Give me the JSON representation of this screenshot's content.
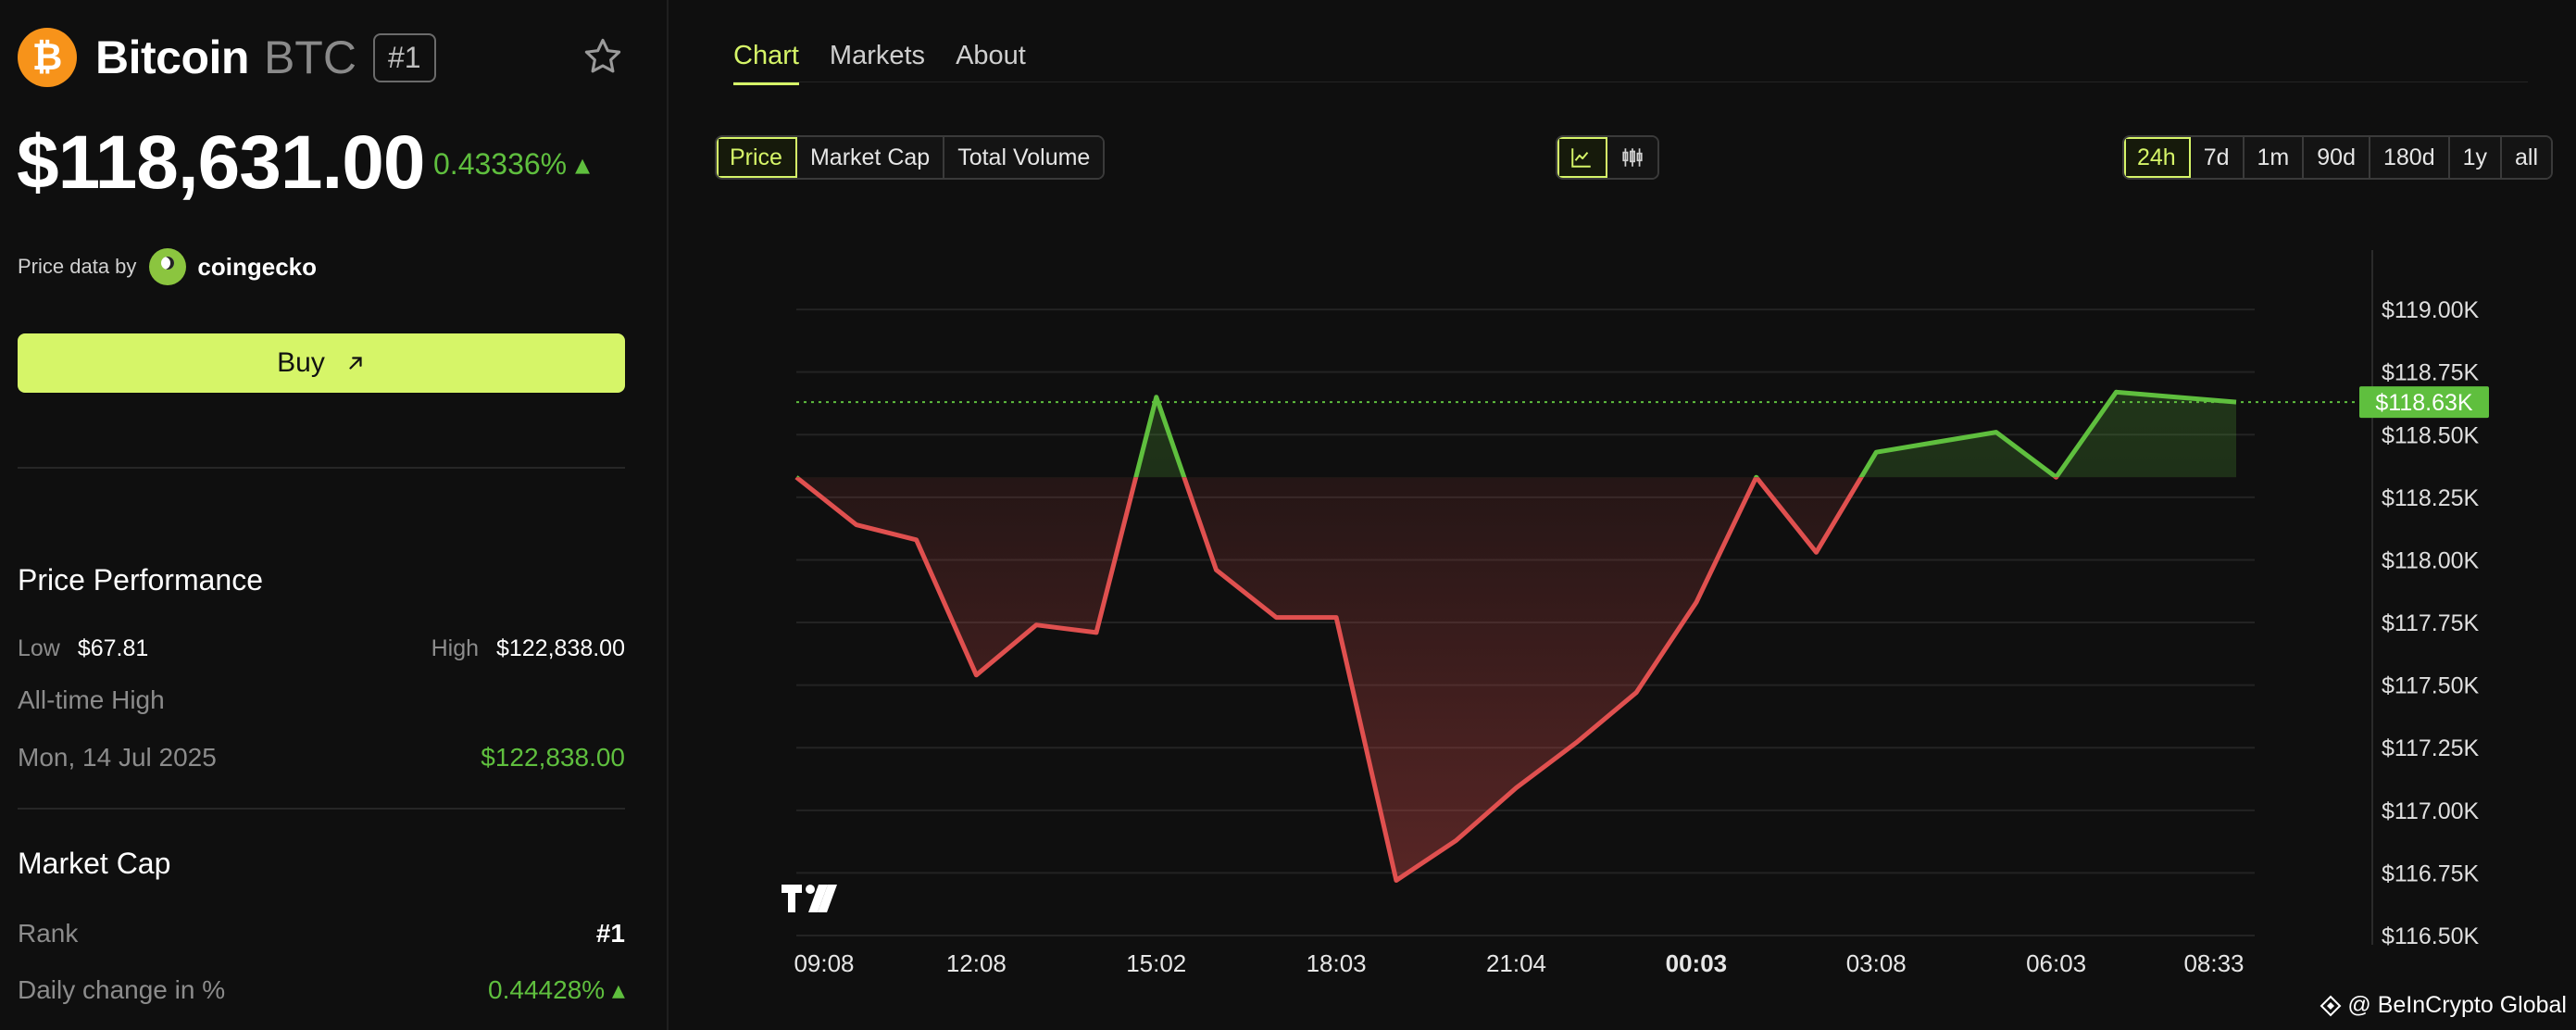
{
  "coin": {
    "logo_glyph": "₿",
    "name": "Bitcoin",
    "symbol": "BTC",
    "rank": "#1",
    "price": "$118,631.00",
    "change": "0.43336% ▴"
  },
  "attribution": {
    "label": "Price data by",
    "provider": "coingecko"
  },
  "buy_label": "Buy",
  "performance": {
    "title": "Price Performance",
    "low_label": "Low",
    "low_value": "$67.81",
    "high_label": "High",
    "high_value": "$122,838.00",
    "ath_label": "All-time High",
    "ath_date": "Mon, 14 Jul 2025",
    "ath_value": "$122,838.00"
  },
  "market_cap": {
    "title": "Market Cap",
    "rank_label": "Rank",
    "rank_value": "#1",
    "daily_label": "Daily change in %",
    "daily_value": "0.44428% ▴"
  },
  "tabs": [
    {
      "label": "Chart",
      "active": true
    },
    {
      "label": "Markets",
      "active": false
    },
    {
      "label": "About",
      "active": false
    }
  ],
  "metric_options": [
    {
      "label": "Price",
      "active": true
    },
    {
      "label": "Market Cap",
      "active": false
    },
    {
      "label": "Total Volume",
      "active": false
    }
  ],
  "chart_types": [
    {
      "icon": "line-chart-icon",
      "active": true
    },
    {
      "icon": "candlestick-icon",
      "active": false
    }
  ],
  "ranges": [
    {
      "label": "24h",
      "active": true
    },
    {
      "label": "7d",
      "active": false
    },
    {
      "label": "1m",
      "active": false
    },
    {
      "label": "90d",
      "active": false
    },
    {
      "label": "180d",
      "active": false
    },
    {
      "label": "1y",
      "active": false
    },
    {
      "label": "all",
      "active": false
    }
  ],
  "watermark": "@ BeInCrypto Global",
  "colors": {
    "accent": "#d6f568",
    "up": "#5fbf3e",
    "down": "#e0504f",
    "bitcoin": "#f7931a"
  },
  "chart_data": {
    "type": "area",
    "y_unit": "K USD",
    "ylim": [
      116.5,
      119.2
    ],
    "yticks": [
      {
        "value": 119.0,
        "label": "$119.00K"
      },
      {
        "value": 118.75,
        "label": "$118.75K"
      },
      {
        "value": 118.5,
        "label": "$118.50K"
      },
      {
        "value": 118.25,
        "label": "$118.25K"
      },
      {
        "value": 118.0,
        "label": "$118.00K"
      },
      {
        "value": 117.75,
        "label": "$117.75K"
      },
      {
        "value": 117.5,
        "label": "$117.50K"
      },
      {
        "value": 117.25,
        "label": "$117.25K"
      },
      {
        "value": 117.0,
        "label": "$117.00K"
      },
      {
        "value": 116.75,
        "label": "$116.75K"
      },
      {
        "value": 116.5,
        "label": "$116.50K"
      }
    ],
    "xticks": [
      {
        "t": 0,
        "label": "09:08",
        "bold": false
      },
      {
        "t": 3,
        "label": "12:08",
        "bold": false
      },
      {
        "t": 6,
        "label": "15:02",
        "bold": false
      },
      {
        "t": 9,
        "label": "18:03",
        "bold": false
      },
      {
        "t": 12,
        "label": "21:04",
        "bold": false
      },
      {
        "t": 15,
        "label": "00:03",
        "bold": true
      },
      {
        "t": 18,
        "label": "03:08",
        "bold": false
      },
      {
        "t": 21,
        "label": "06:03",
        "bold": false
      },
      {
        "t": 24,
        "label": "08:33",
        "bold": false
      }
    ],
    "baseline": 118.33,
    "current": {
      "value": 118.63,
      "label": "$118.63K"
    },
    "points": [
      {
        "t": 0,
        "v": 118.33
      },
      {
        "t": 1,
        "v": 118.14
      },
      {
        "t": 2,
        "v": 118.08
      },
      {
        "t": 3,
        "v": 117.54
      },
      {
        "t": 4,
        "v": 117.74
      },
      {
        "t": 5,
        "v": 117.71
      },
      {
        "t": 6,
        "v": 118.65
      },
      {
        "t": 7,
        "v": 117.96
      },
      {
        "t": 8,
        "v": 117.77
      },
      {
        "t": 9,
        "v": 117.77
      },
      {
        "t": 10,
        "v": 116.72
      },
      {
        "t": 11,
        "v": 116.88
      },
      {
        "t": 12,
        "v": 117.09
      },
      {
        "t": 13,
        "v": 117.27
      },
      {
        "t": 14,
        "v": 117.47
      },
      {
        "t": 15,
        "v": 117.83
      },
      {
        "t": 16,
        "v": 118.33
      },
      {
        "t": 17,
        "v": 118.03
      },
      {
        "t": 18,
        "v": 118.43
      },
      {
        "t": 19,
        "v": 118.47
      },
      {
        "t": 20,
        "v": 118.51
      },
      {
        "t": 21,
        "v": 118.33
      },
      {
        "t": 22,
        "v": 118.67
      },
      {
        "t": 23,
        "v": 118.65
      },
      {
        "t": 24,
        "v": 118.63
      }
    ],
    "grid": true
  }
}
